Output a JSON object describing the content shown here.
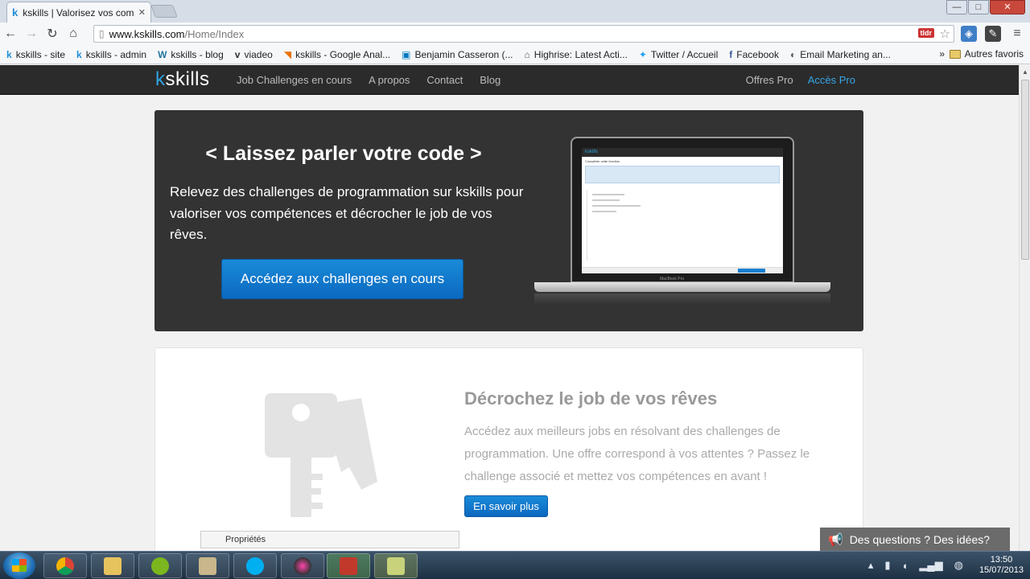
{
  "browser": {
    "tab_title": "kskills | Valorisez vos com",
    "tab_favicon": "k",
    "tab_close": "✕",
    "url_host": "www.kskills.com",
    "url_path": "/Home/Index",
    "tldr_badge": "tldr",
    "window_controls": {
      "minimize": "—",
      "maximize": "□",
      "close": "✕"
    }
  },
  "bookmarks": {
    "items": [
      {
        "icon": "k",
        "label": "kskills - site"
      },
      {
        "icon": "k",
        "label": "kskills - admin"
      },
      {
        "icon": "W",
        "label": "kskills - blog"
      },
      {
        "icon": "v",
        "label": "viadeo"
      },
      {
        "icon": "◥",
        "label": "kskills - Google Anal..."
      },
      {
        "icon": "▣",
        "label": "Benjamin Casseron (..."
      },
      {
        "icon": "⌂",
        "label": "Highrise: Latest Acti..."
      },
      {
        "icon": "✦",
        "label": "Twitter / Accueil"
      },
      {
        "icon": "f",
        "label": "Facebook"
      },
      {
        "icon": "◐",
        "label": "Email Marketing an..."
      }
    ],
    "overflow": "»",
    "other": "Autres favoris"
  },
  "site": {
    "logo_k": "k",
    "logo_rest": "skills",
    "nav": [
      "Job Challenges en cours",
      "A propos",
      "Contact",
      "Blog"
    ],
    "offres_pro": "Offres Pro",
    "acces_pro": "Accès Pro"
  },
  "hero": {
    "title": "< Laissez parler votre code >",
    "text": "Relevez des challenges de programmation sur kskills pour valoriser vos compétences et décrocher le job de vos rêves.",
    "cta": "Accédez aux challenges en cours"
  },
  "jobs": {
    "title": "Décrochez le job de vos rêves",
    "text": "Accédez aux meilleurs jobs en résolvant des challenges de programmation. Une offre correspond à vos attentes ? Passez le challenge associé et mettez vos compétences en avant !",
    "more": "En savoir plus"
  },
  "properties_label": "Propriétés",
  "feedback": "Des questions ? Des idées?",
  "taskbar": {
    "time": "13:50",
    "date": "15/07/2013"
  },
  "colors": {
    "brand_blue": "#2ea3e0",
    "button_blue": "#0b69c0",
    "hero_bg": "#333333",
    "nav_bg": "#2b2b2b"
  }
}
